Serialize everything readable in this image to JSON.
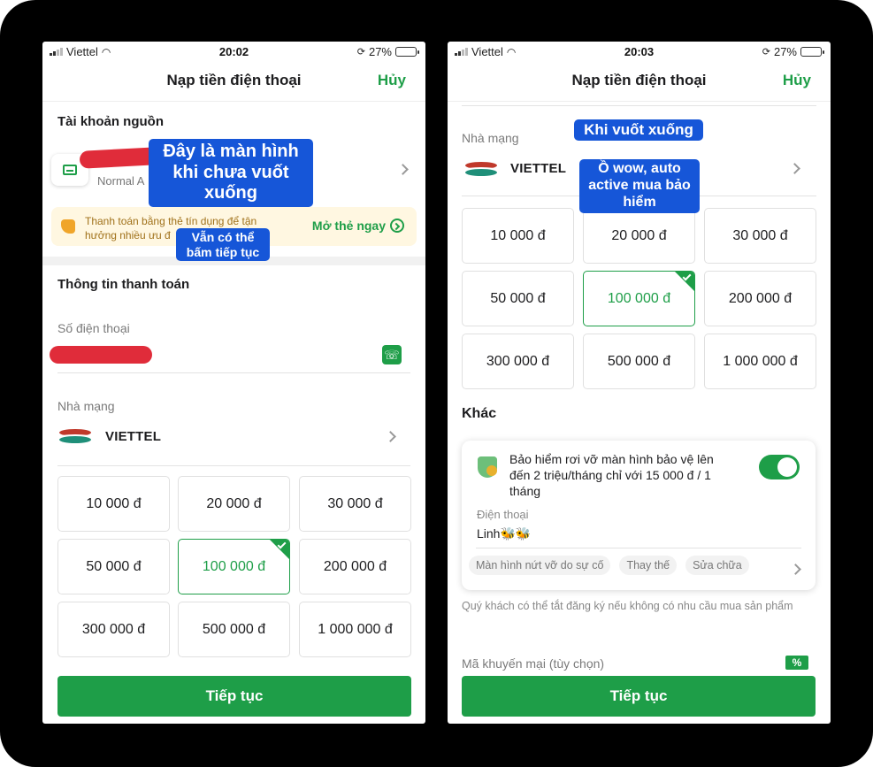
{
  "left": {
    "status": {
      "carrier": "Viettel",
      "time": "20:02",
      "battery": "27%"
    },
    "nav": {
      "title": "Nạp tiền điện thoại",
      "cancel": "Hủy"
    },
    "source_section_title": "Tài khoản nguồn",
    "account_sub": "Normal A",
    "promo": {
      "text": "Thanh toán bằng thẻ tín dụng để tận hưởng nhiều ưu đ",
      "link": "Mở thẻ ngay"
    },
    "payment_section_title": "Thông tin thanh toán",
    "phone_label": "Số điện thoại",
    "phone_book_icon": "contact-book-icon",
    "carrier_label": "Nhà mạng",
    "carrier_name": "VIETTEL",
    "amounts": [
      "10 000 đ",
      "20 000 đ",
      "30 000 đ",
      "50 000 đ",
      "100 000 đ",
      "200 000 đ",
      "300 000 đ",
      "500 000 đ",
      "1 000 000 đ"
    ],
    "selected_amount": "100 000 đ",
    "continue": "Tiếp tục"
  },
  "right": {
    "status": {
      "carrier": "Viettel",
      "time": "20:03",
      "battery": "27%"
    },
    "nav": {
      "title": "Nạp tiền điện thoại",
      "cancel": "Hủy"
    },
    "carrier_label": "Nhà mạng",
    "carrier_name": "VIETTEL",
    "amounts": [
      "10 000 đ",
      "20 000 đ",
      "30 000 đ",
      "50 000 đ",
      "100 000 đ",
      "200 000 đ",
      "300 000 đ",
      "500 000 đ",
      "1 000 000 đ"
    ],
    "selected_amount": "100 000 đ",
    "other_title": "Khác",
    "insurance": {
      "title": "Bảo hiểm rơi vỡ màn hình bảo vệ lên đến 2 triệu/tháng chỉ với 15 000 đ / 1 tháng",
      "toggle_on": true,
      "phone_label": "Điện thoại",
      "phone_value": "Linh🐝🐝",
      "chips": [
        "Màn hình nứt vỡ do sự cố",
        "Thay thế",
        "Sửa chữa"
      ]
    },
    "hint": "Quý khách có thể tắt đăng ký nếu không có nhu cầu mua sản phẩm",
    "promo_code_label": "Mã khuyến mại (tùy chọn)",
    "promo_code_icon": "%",
    "continue": "Tiếp tục"
  },
  "annotations": {
    "left_main": "Đây là màn hình khi chưa vuốt xuống",
    "left_sub": "Vẫn có thể bấm tiếp tục",
    "right_top": "Khi vuốt xuống",
    "right_sub": "Ồ wow, auto active mua bảo hiểm"
  },
  "colors": {
    "accent": "#1e9e48",
    "annotation": "#1656d8",
    "redaction": "#e02c3a",
    "frame": "#000000"
  }
}
